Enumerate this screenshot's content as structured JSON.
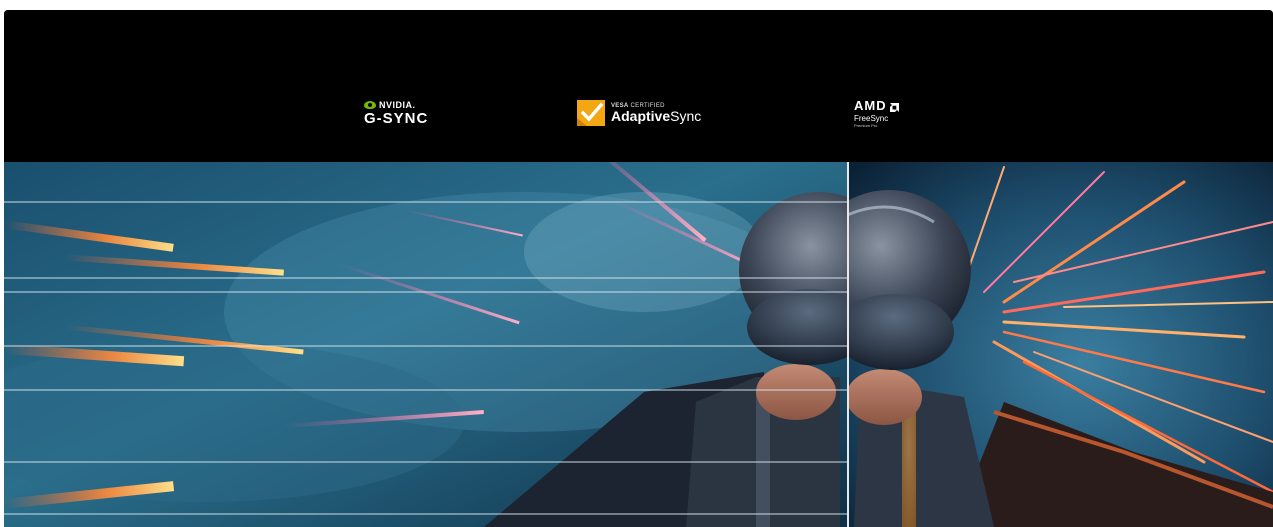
{
  "logos": {
    "nvidia_label": "NVIDIA.",
    "gsync_label": "G-SYNC",
    "vesa_certified_prefix": "VESA",
    "vesa_certified_suffix": "CERTIFIED",
    "adaptive_bold": "Adaptive",
    "adaptive_rest": "Sync",
    "amd_label": "AMD",
    "freesync_label": "FreeSync",
    "premium_pro_label": "Premium Pro"
  },
  "colors": {
    "background": "#000000",
    "nvidia_green": "#76b900",
    "vesa_orange": "#f3a712",
    "divider": "#e8e8e8"
  },
  "icons": {
    "nvidia": "nvidia-eye-icon",
    "vesa": "vesa-checkmark-badge-icon",
    "amd": "amd-arrow-icon"
  },
  "scene": {
    "subject": "fighter-pilot-comparison",
    "left_half": "screen-tearing",
    "right_half": "smooth"
  }
}
